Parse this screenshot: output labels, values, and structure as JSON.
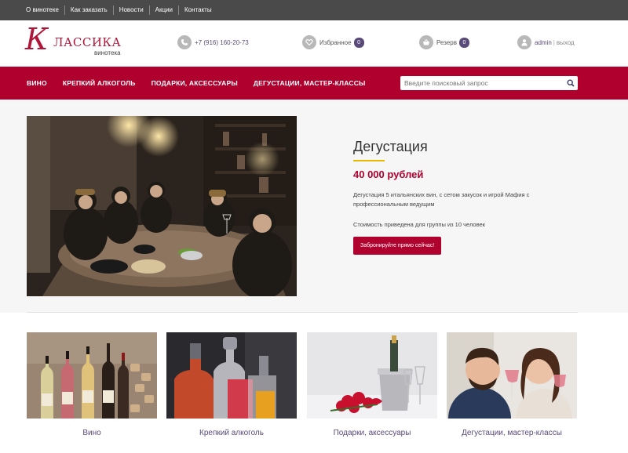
{
  "topbar": {
    "links": [
      "О винотеке",
      "Как заказать",
      "Новости",
      "Акции",
      "Контакты"
    ]
  },
  "header": {
    "logo_letter": "К",
    "logo_word": "ЛАССИКА",
    "logo_sub": "винотека",
    "phone": "+7 (916) 160-20-73",
    "favorites_label": "Избранное",
    "favorites_count": "0",
    "reserve_label": "Резерв",
    "reserve_count": "0",
    "user_name": "admin",
    "separator": "|",
    "logout_label": "выход"
  },
  "nav": {
    "items": [
      "ВИНО",
      "КРЕПКИЙ АЛКОГОЛЬ",
      "ПОДАРКИ, АКСЕССУАРЫ",
      "ДЕГУСТАЦИИ, МАСТЕР-КЛАССЫ"
    ],
    "search_placeholder": "Введите поисковый запрос"
  },
  "product": {
    "title": "Дегустация",
    "price": "40 000 рублей",
    "description": "Дегустация 5 итальянских вин, с сетом закусок и игрой Мафия с профессиональным ведущим",
    "note": "Стоимость приведена для группы из 10 человек",
    "cta_label": "Забронируйте прямо сейчас!"
  },
  "categories": [
    "Вино",
    "Крепкий алкоголь",
    "Подарки, аксессуары",
    "Дегустации, мастер-классы"
  ],
  "colors": {
    "brand": "#b0002e",
    "accent_underline": "#e6b800",
    "link": "#5a4a7a",
    "topbar": "#4a4a4a"
  },
  "icons": {
    "phone": "phone-icon",
    "favorites": "heart-icon",
    "reserve": "basket-icon",
    "user": "user-icon",
    "search": "search-icon"
  }
}
